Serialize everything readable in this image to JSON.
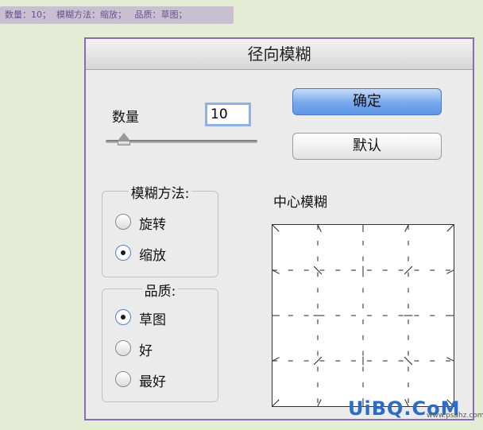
{
  "caption": "数量：10；  模糊方法：缩放；   品质：草图；",
  "dialog": {
    "title": "径向模糊",
    "amount": {
      "label": "数量",
      "value": "10",
      "slider_fraction": 0.1
    },
    "buttons": {
      "ok": "确定",
      "default": "默认"
    },
    "blur_method": {
      "title": "模糊方法:",
      "options": [
        {
          "label": "旋转",
          "selected": false
        },
        {
          "label": "缩放",
          "selected": true
        }
      ]
    },
    "quality": {
      "title": "品质:",
      "options": [
        {
          "label": "草图",
          "selected": true
        },
        {
          "label": "好",
          "selected": false
        },
        {
          "label": "最好",
          "selected": false
        }
      ]
    },
    "center_label": "中心模糊"
  },
  "watermark": {
    "brand": "UiBQ.CoM",
    "site": "www.psahz.com"
  },
  "colors": {
    "dialog_border": "#8a6bb6",
    "ok_button": "#78a8ec",
    "background": "#e4ecd6"
  }
}
